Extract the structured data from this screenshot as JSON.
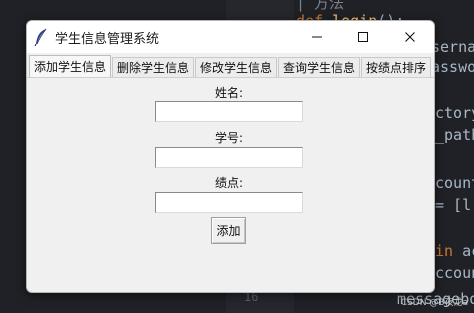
{
  "window": {
    "title": "学生信息管理系统",
    "minimize_glyph": "—",
    "close_glyph": "✕"
  },
  "tabs": [
    {
      "label": "添加学生信息",
      "active": true
    },
    {
      "label": "删除学生信息",
      "active": false
    },
    {
      "label": "修改学生信息",
      "active": false
    },
    {
      "label": "查询学生信息",
      "active": false
    },
    {
      "label": "按绩点排序",
      "active": false
    }
  ],
  "form": {
    "name_label": "姓名:",
    "name_value": "",
    "id_label": "学号:",
    "id_value": "",
    "gpa_label": "绩点:",
    "gpa_value": "",
    "add_button": "添加"
  },
  "background_code": {
    "lines": [
      "| 方法",
      "def login():",
      "sernam",
      "asswor",
      "ctory",
      "_path",
      "count",
      "= [l",
      "in ac",
      "ccount",
      "messagebo"
    ],
    "line_number": "16",
    "watermark": "CSDN @B夜龙a"
  },
  "colors": {
    "window_bg": "#f0f0f0",
    "titlebar_bg": "#ffffff",
    "ide_bg": "#1f2126"
  },
  "icons": [
    "feather-icon",
    "minimize-icon",
    "maximize-icon",
    "close-icon"
  ]
}
